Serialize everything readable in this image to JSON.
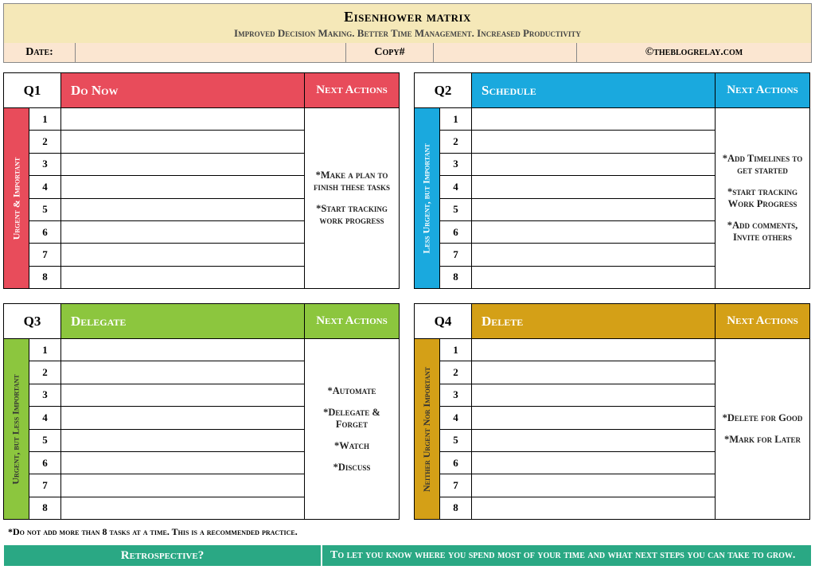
{
  "header": {
    "title": "Eisenhower matrix",
    "subtitle": "Improved Decision Making. Better Time Management. Increased Productivity",
    "date_label": "Date:",
    "date_value": "",
    "copy_label": "Copy#",
    "copy_value": "",
    "credit": "©theblogrelay.com"
  },
  "row_numbers": [
    "1",
    "2",
    "3",
    "4",
    "5",
    "6",
    "7",
    "8"
  ],
  "next_actions_label": "Next Actions",
  "quadrants": [
    {
      "code": "Q1",
      "title": "Do Now",
      "side": "Urgent & Important",
      "color_class": "q1-c",
      "side_text_class": "",
      "actions": [
        "*Make a plan to finish these tasks",
        "*Start tracking work progress"
      ]
    },
    {
      "code": "Q2",
      "title": "Schedule",
      "side": "Less Urgent, but Important",
      "color_class": "q2-c",
      "side_text_class": "",
      "actions": [
        "*Add Timelines to get started",
        "*start tracking Work Progress",
        "*Add comments, Invite others"
      ]
    },
    {
      "code": "Q3",
      "title": "Delegate",
      "side": "Urgent, but Less Important",
      "color_class": "q3-c",
      "side_text_class": "q3-side-text",
      "actions": [
        "*Automate",
        "*Delegate & Forget",
        "*Watch",
        "*Discuss"
      ]
    },
    {
      "code": "Q4",
      "title": "Delete",
      "side": "Neither Urgent Nor Important",
      "color_class": "q4-c",
      "side_text_class": "q4-side-text",
      "actions": [
        "*Delete for Good",
        "*Mark for Later"
      ]
    }
  ],
  "footnote": "*Do not add more than 8 tasks at a time. This is a recommended practice.",
  "retro": {
    "label": "Retrospective?",
    "text": "To let you know where you spend most of your time and what next steps you can take to grow."
  }
}
